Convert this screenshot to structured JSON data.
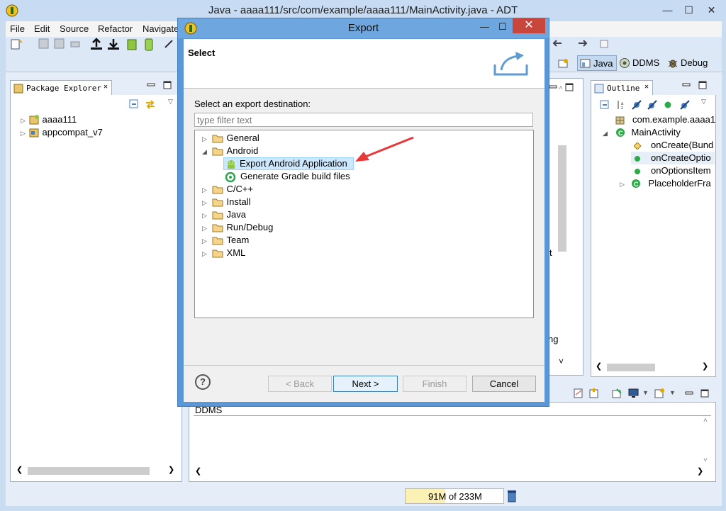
{
  "window": {
    "title": "Java - aaaa111/src/com/example/aaaa111/MainActivity.java - ADT",
    "controls": {
      "minimize": "—",
      "maximize": "☐",
      "close": "✕"
    }
  },
  "menu": [
    "File",
    "Edit",
    "Source",
    "Refactor",
    "Navigate"
  ],
  "perspectives": [
    {
      "label": "Java",
      "icon": "java-perspective-icon"
    },
    {
      "label": "DDMS",
      "icon": "ddms-icon"
    },
    {
      "label": "Debug",
      "icon": "debug-icon"
    }
  ],
  "package_explorer": {
    "tab": "Package Explorer",
    "items": [
      {
        "label": "aaaa111",
        "icon": "android-project-icon"
      },
      {
        "label": "appcompat_v7",
        "icon": "java-project-icon"
      }
    ]
  },
  "outline": {
    "tab": "Outline",
    "items": [
      {
        "label": "com.example.aaaa1"
      },
      {
        "label": "MainActivity"
      },
      {
        "label": "onCreate(Bund"
      },
      {
        "label": "onCreateOptio"
      },
      {
        "label": "onOptionsItem"
      },
      {
        "label": "PlaceholderFra"
      }
    ]
  },
  "bottom_panel": {
    "label": "DDMS"
  },
  "editor_fragments": {
    "t": "t",
    "ng": "ng",
    "chevron": "˅"
  },
  "status": {
    "memory": "91M of 233M"
  },
  "dialog": {
    "title": "Export",
    "close": "✕",
    "header_title": "Select",
    "prompt": "Select an export destination:",
    "filter_placeholder": "type filter text",
    "tree": [
      {
        "label": "General",
        "expanded": false
      },
      {
        "label": "Android",
        "expanded": true,
        "children": [
          {
            "label": "Export Android Application",
            "selected": true,
            "icon": "android-icon"
          },
          {
            "label": "Generate Gradle build files",
            "icon": "gradle-icon"
          }
        ]
      },
      {
        "label": "C/C++",
        "expanded": false
      },
      {
        "label": "Install",
        "expanded": false
      },
      {
        "label": "Java",
        "expanded": false
      },
      {
        "label": "Run/Debug",
        "expanded": false
      },
      {
        "label": "Team",
        "expanded": false
      },
      {
        "label": "XML",
        "expanded": false
      }
    ],
    "help": "?",
    "buttons": {
      "back": "< Back",
      "next": "Next >",
      "finish": "Finish",
      "cancel": "Cancel"
    }
  },
  "colors": {
    "dialog_frame": "#5b97d6",
    "close_button": "#c9463d",
    "annotation_arrow": "#e8383a",
    "selection": "#cce8ff"
  }
}
